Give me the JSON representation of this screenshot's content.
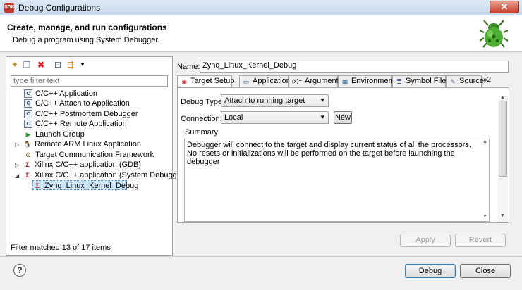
{
  "window": {
    "title": "Debug Configurations",
    "app_badge": "SDK",
    "close_glyph": "✕"
  },
  "banner": {
    "title": "Create, manage, and run configurations",
    "subtitle": "Debug a program using System Debugger.",
    "icon": "bug-icon"
  },
  "left": {
    "filter_placeholder": "type filter text",
    "tree": [
      {
        "label": "C/C++ Application",
        "icon": "cpp-launch-icon",
        "glyph": "C"
      },
      {
        "label": "C/C++ Attach to Application",
        "icon": "cpp-launch-icon",
        "glyph": "C"
      },
      {
        "label": "C/C++ Postmortem Debugger",
        "icon": "cpp-launch-icon",
        "glyph": "C"
      },
      {
        "label": "C/C++ Remote Application",
        "icon": "cpp-launch-icon",
        "glyph": "C"
      },
      {
        "label": "Launch Group",
        "icon": "play-icon",
        "glyph": "▶"
      },
      {
        "label": "Remote ARM Linux Application",
        "icon": "linux-penguin-icon",
        "glyph": "🐧"
      },
      {
        "label": "Target Communication Framework",
        "icon": "tcf-icon",
        "glyph": "⚙"
      },
      {
        "label": "Xilinx C/C++ application (GDB)",
        "icon": "gdb-icon",
        "glyph": "Σ"
      },
      {
        "label": "Xilinx C/C++ application (System Debugger)",
        "icon": "system-debugger-icon",
        "glyph": "Σ"
      },
      {
        "label": "Zynq_Linux_Kernel_Debug",
        "icon": "system-debugger-icon",
        "glyph": "Σ"
      }
    ],
    "status": "Filter matched 13 of 17 items"
  },
  "right": {
    "name_label": "Name:",
    "name_value": "Zynq_Linux_Kernel_Debug",
    "tabs": [
      {
        "label": "Target Setup",
        "icon": "target-icon",
        "glyph": "◉"
      },
      {
        "label": "Application",
        "icon": "application-icon",
        "glyph": "▭"
      },
      {
        "label": "Arguments",
        "icon": "arguments-icon",
        "glyph": "(x)="
      },
      {
        "label": "Environment",
        "icon": "environment-icon",
        "glyph": "▦"
      },
      {
        "label": "Symbol Files",
        "icon": "symbol-files-icon",
        "glyph": "≣"
      },
      {
        "label": "Source",
        "icon": "source-icon",
        "glyph": "✎"
      }
    ],
    "tabs_overflow": "»2",
    "debug_type_label": "Debug Type:",
    "debug_type_value": "Attach to running target",
    "connection_label": "Connection:",
    "connection_value": "Local",
    "new_button": "New",
    "summary_label": "Summary",
    "summary_lines": [
      "Debugger will connect to the target and display current status of all the processors.",
      "No resets or initializations will be performed on the target before launching the debugger"
    ],
    "apply_button": "Apply",
    "revert_button": "Revert"
  },
  "footer": {
    "help_glyph": "?",
    "debug_button": "Debug",
    "close_button": "Close"
  },
  "colors": {
    "selection": "#cde8ff",
    "tab_active_icon": "#d03030",
    "bug_green": "#4caf32"
  }
}
